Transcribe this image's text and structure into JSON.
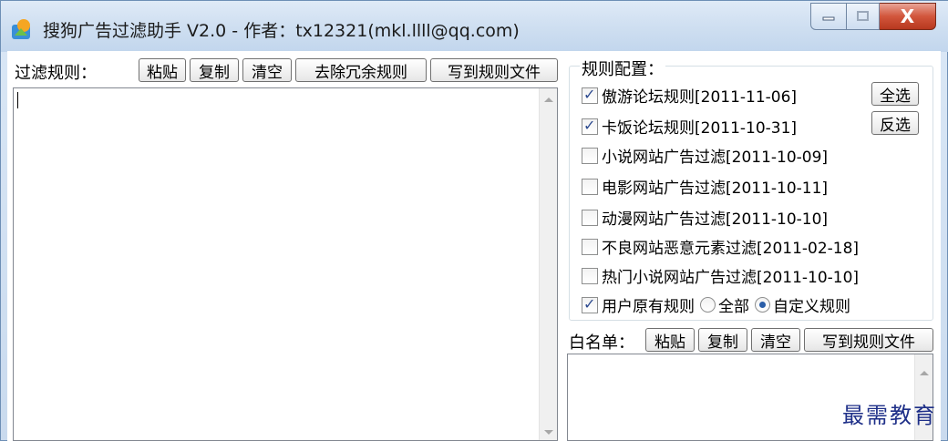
{
  "window": {
    "title": "搜狗广告过滤助手 V2.0 - 作者：tx12321(mkl.llll@qq.com)",
    "close_glyph": "X"
  },
  "filter": {
    "label": "过滤规则：",
    "buttons": [
      "粘贴",
      "复制",
      "清空",
      "去除冗余规则",
      "写到规则文件"
    ]
  },
  "config": {
    "title": "规则配置：",
    "select_all": "全选",
    "invert": "反选",
    "rules": [
      {
        "label": "傲游论坛规则[2011-11-06]",
        "checked": true
      },
      {
        "label": "卡饭论坛规则[2011-10-31]",
        "checked": true
      },
      {
        "label": "小说网站广告过滤[2011-10-09]",
        "checked": false
      },
      {
        "label": "电影网站广告过滤[2011-10-11]",
        "checked": false
      },
      {
        "label": "动漫网站广告过滤[2011-10-10]",
        "checked": false
      },
      {
        "label": "不良网站恶意元素过滤[2011-02-18]",
        "checked": false
      },
      {
        "label": "热门小说网站广告过滤[2011-10-10]",
        "checked": false
      }
    ],
    "user_rules": {
      "label": "用户原有规则",
      "checked": true
    },
    "radio_all": "全部",
    "radio_custom": "自定义规则"
  },
  "whitelist": {
    "label": "白名单：",
    "buttons": [
      "粘贴",
      "复制",
      "清空",
      "写到规则文件"
    ]
  },
  "watermark": "最需教育"
}
